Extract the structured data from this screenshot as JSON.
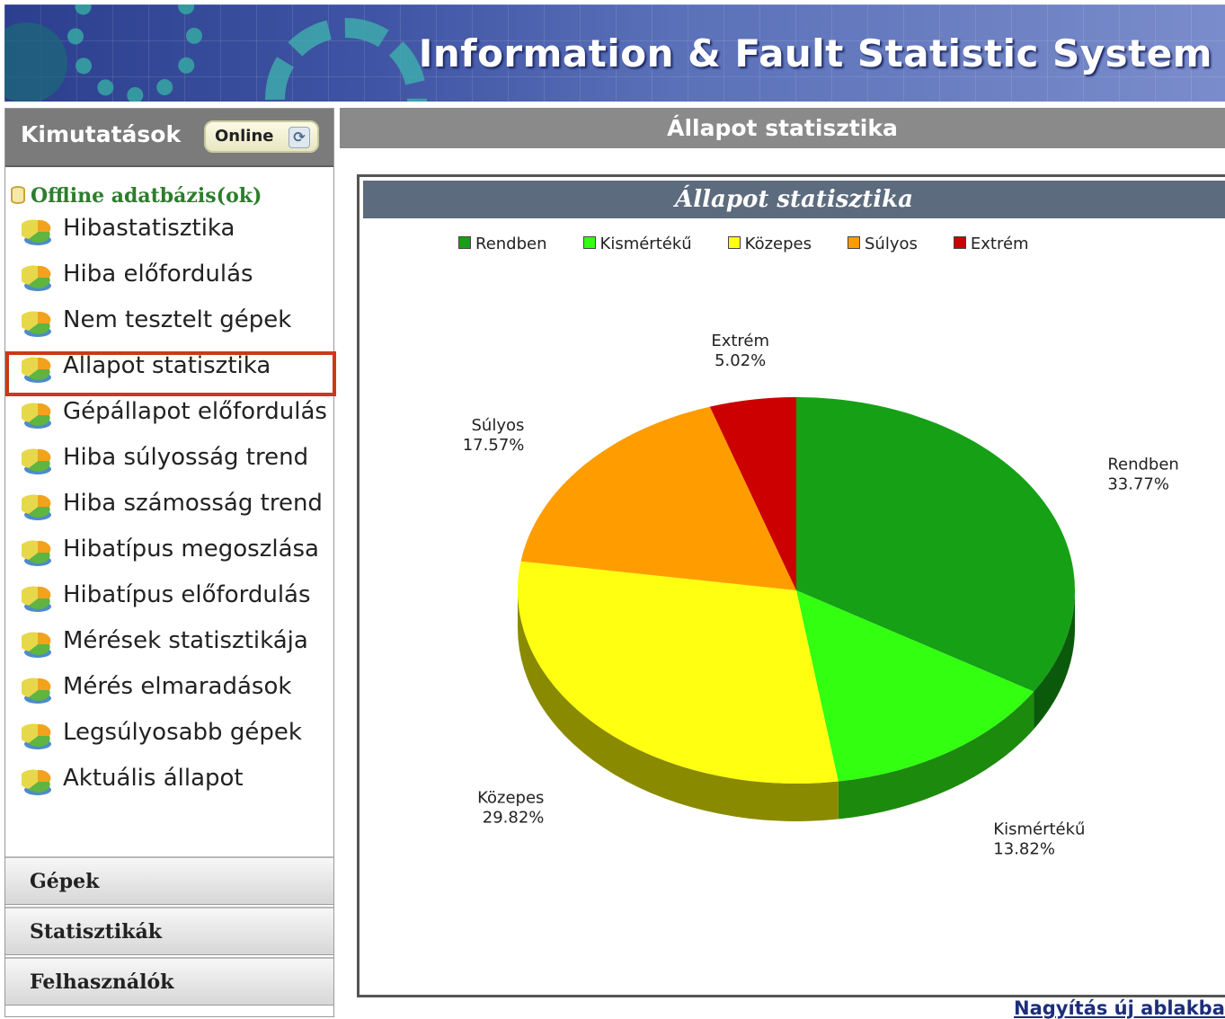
{
  "app": {
    "title": "Information & Fault Statistic System"
  },
  "sidebar": {
    "header_label": "Kimutatások",
    "online_button": "Online",
    "db_label": "Offline adatbázis(ok)",
    "items": [
      {
        "label": "Hibastatisztika"
      },
      {
        "label": "Hiba előfordulás"
      },
      {
        "label": "Nem tesztelt gépek"
      },
      {
        "label": "Állapot statisztika",
        "selected": true
      },
      {
        "label": "Gépállapot előfordulás"
      },
      {
        "label": "Hiba súlyosság trend"
      },
      {
        "label": "Hiba számosság trend"
      },
      {
        "label": "Hibatípus megoszlása"
      },
      {
        "label": "Hibatípus előfordulás"
      },
      {
        "label": "Mérések statisztikája"
      },
      {
        "label": "Mérés elmaradások"
      },
      {
        "label": "Legsúlyosabb gépek"
      },
      {
        "label": "Aktuális állapot"
      }
    ],
    "sections": [
      "Gépek",
      "Statisztikák",
      "Felhasználók"
    ]
  },
  "main": {
    "header": "Állapot statisztika",
    "zoom_link": "Nagyítás új ablakban"
  },
  "chart_data": {
    "type": "pie",
    "title": "Állapot statisztika",
    "legend_position": "top",
    "slices": [
      {
        "name": "Rendben",
        "value": 33.77,
        "label": "33.77%",
        "color": "#16a016",
        "side": "#0b5a0b"
      },
      {
        "name": "Kismértékű",
        "value": 13.82,
        "label": "13.82%",
        "color": "#33ff11",
        "side": "#1c8a0c"
      },
      {
        "name": "Közepes",
        "value": 29.82,
        "label": "29.82%",
        "color": "#ffff11",
        "side": "#8a8a00"
      },
      {
        "name": "Súlyos",
        "value": 17.57,
        "label": "17.57%",
        "color": "#ff9d00",
        "side": "#8a5400"
      },
      {
        "name": "Extrém",
        "value": 5.02,
        "label": "5.02%",
        "color": "#cc0000",
        "side": "#6a0000"
      }
    ]
  }
}
